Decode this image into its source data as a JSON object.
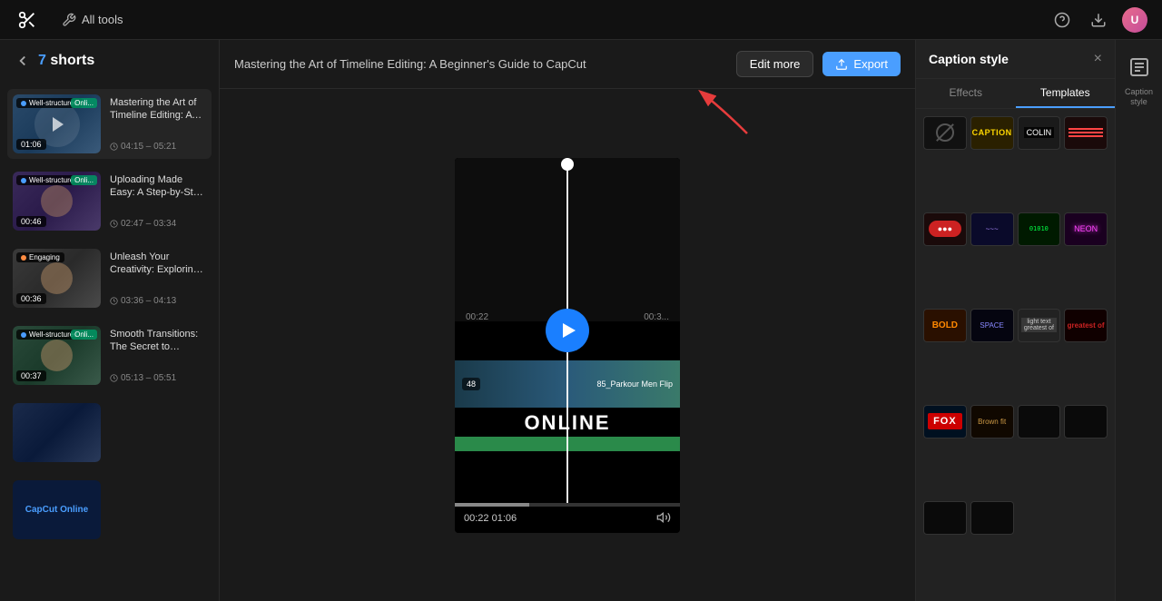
{
  "app": {
    "logo": "✂",
    "all_tools_label": "All tools",
    "nav_icons": [
      "help",
      "download",
      "avatar"
    ]
  },
  "header": {
    "back_label": "←",
    "shorts_count": "7",
    "shorts_label": "shorts",
    "video_title": "Mastering the Art of Timeline Editing: A Beginner's Guide to CapCut",
    "edit_more_label": "Edit more",
    "export_label": "Export"
  },
  "sidebar": {
    "videos": [
      {
        "title": "Mastering the Art of Timeline Editing: A Beginner's Guide to...",
        "badge": "Well-structured",
        "online": true,
        "duration": "01:06",
        "time_range": "04:15 – 05:21",
        "badge_color": "#4a9eff"
      },
      {
        "title": "Uploading Made Easy: A Step-by-Step Guide to Starting Your Project",
        "badge": "Well-structured",
        "online": true,
        "duration": "00:46",
        "time_range": "02:47 – 03:34",
        "badge_color": "#4a9eff"
      },
      {
        "title": "Unleash Your Creativity: Exploring the Magic of Stock Footage and...",
        "badge": "Engaging",
        "online": false,
        "duration": "00:36",
        "time_range": "03:36 – 04:13",
        "badge_color": "#ff8c42"
      },
      {
        "title": "Smooth Transitions: The Secret to Seamless Video Edits in CapCut",
        "badge": "Well-structured",
        "online": true,
        "duration": "00:37",
        "time_range": "05:13 – 05:51",
        "badge_color": "#4a9eff"
      },
      {
        "title": "",
        "badge": "",
        "online": false,
        "duration": "",
        "time_range": "",
        "badge_color": "#4a9eff"
      },
      {
        "title": "CapCut Online",
        "badge": "",
        "online": false,
        "duration": "",
        "time_range": "",
        "badge_color": "#4a9eff"
      }
    ]
  },
  "player": {
    "current_time": "00:22",
    "total_time": "01:06",
    "overlay_text": "ONLINE",
    "strip_badge": "48",
    "strip_title": "85_Parkour Men Flip"
  },
  "caption_panel": {
    "title": "Caption style",
    "close_label": "×",
    "tabs": [
      "Effects",
      "Templates"
    ],
    "active_tab": "Templates",
    "styles": [
      {
        "id": "none",
        "label": ""
      },
      {
        "id": "caption",
        "label": "CAPTION",
        "tile_class": "tile-yellow"
      },
      {
        "id": "dark",
        "label": "COLIN",
        "tile_class": "tile-dark"
      },
      {
        "id": "stripe",
        "label": "▬▬▬",
        "tile_class": "tile-red"
      },
      {
        "id": "red-pill",
        "label": "●●●",
        "tile_class": "tile-red"
      },
      {
        "id": "purple-wave",
        "label": "~~~",
        "tile_class": "tile-purple"
      },
      {
        "id": "matrix",
        "label": "01010",
        "tile_class": "tile-matrix"
      },
      {
        "id": "neon",
        "label": "NEON",
        "tile_class": "tile-neon"
      },
      {
        "id": "orange-bold",
        "label": "BOLD",
        "tile_class": "tile-orange"
      },
      {
        "id": "space",
        "label": "SPACE",
        "tile_class": "tile-space"
      },
      {
        "id": "light",
        "label": "light text",
        "tile_class": "tile-light"
      },
      {
        "id": "darkred",
        "label": "greatest of",
        "tile_class": "tile-darkred"
      },
      {
        "id": "electric",
        "label": "FOX",
        "tile_class": "tile-fox"
      },
      {
        "id": "brown",
        "label": "Brown fit",
        "tile_class": "tile-brown"
      },
      {
        "id": "glow4",
        "label": "",
        "tile_class": "tile-glow"
      },
      {
        "id": "glow5",
        "label": "",
        "tile_class": "tile-glow"
      },
      {
        "id": "glow6",
        "label": "",
        "tile_class": "tile-glow"
      },
      {
        "id": "glow7",
        "label": "",
        "tile_class": "tile-glow"
      }
    ]
  }
}
